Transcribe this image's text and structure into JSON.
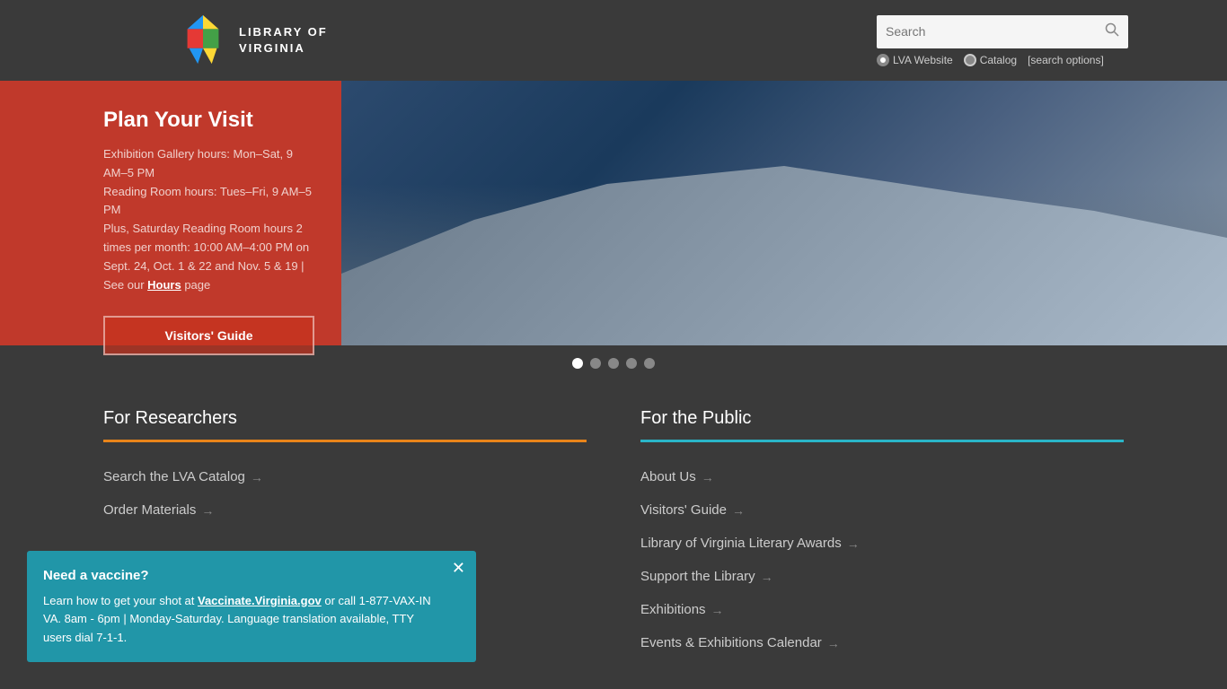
{
  "header": {
    "logo_text_line1": "LIBRARY OF",
    "logo_text_line2": "VIRGINIA",
    "search_placeholder": "Search",
    "radio_lva": "LVA Website",
    "radio_catalog": "Catalog",
    "search_options_link": "[search options]"
  },
  "carousel": {
    "slide": {
      "title": "Plan Your Visit",
      "body": "Exhibition Gallery hours: Mon–Sat, 9 AM–5 PM\nReading Room hours: Tues–Fri, 9 AM–5 PM\nPlus, Saturday Reading Room hours 2 times per month: 10:00 AM–4:00 PM on Sept. 24, Oct. 1 & 22 and Nov. 5 & 19 | See our ",
      "hours_link": "Hours",
      "body_suffix": " page",
      "button_label": "Visitors' Guide"
    },
    "dots": [
      {
        "active": true
      },
      {
        "active": false
      },
      {
        "active": false
      },
      {
        "active": false
      },
      {
        "active": false
      }
    ]
  },
  "researchers": {
    "title": "For Researchers",
    "links": [
      {
        "label": "Search the LVA Catalog",
        "arrow": "→"
      },
      {
        "label": "Order Materials",
        "arrow": "→"
      }
    ]
  },
  "public": {
    "title": "For the Public",
    "links": [
      {
        "label": "About Us",
        "arrow": "→"
      },
      {
        "label": "Visitors' Guide",
        "arrow": "→"
      },
      {
        "label": "Library of Virginia Literary Awards",
        "arrow": "→"
      },
      {
        "label": "Support the Library",
        "arrow": "→"
      },
      {
        "label": "Exhibitions",
        "arrow": "→"
      },
      {
        "label": "Events & Exhibitions Calendar",
        "arrow": "→"
      }
    ]
  },
  "vaccine": {
    "title": "Need a vaccine?",
    "body_before_link": "Learn how to get your shot at ",
    "link_text": "Vaccinate.Virginia.gov",
    "link_url": "#",
    "body_after_link": " or call 1-877-VAX-IN VA. 8am - 6pm | Monday-Saturday. Language translation available, TTY users dial 7-1-1.",
    "close_icon": "✕"
  }
}
